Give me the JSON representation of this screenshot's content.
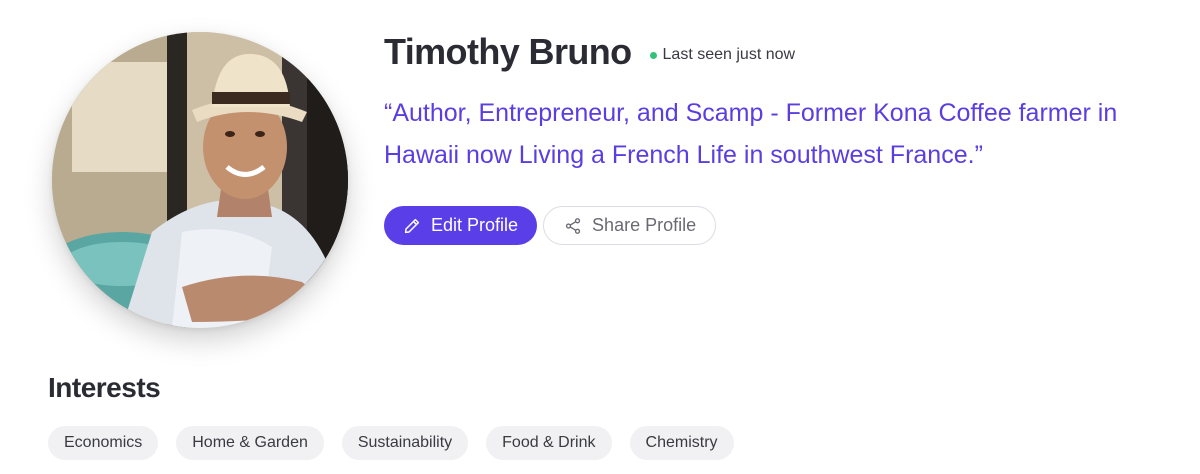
{
  "profile": {
    "name": "Timothy Bruno",
    "presence": "Last seen just now",
    "bio_line1": "“Author, Entrepreneur, and Scamp - Former Kona Coffee farmer in",
    "bio_line2": "Hawaii now Living a French Life in southwest France.”"
  },
  "actions": {
    "edit_label": "Edit Profile",
    "edit_icon": "pencil-icon",
    "share_label": "Share Profile",
    "share_icon": "share-icon"
  },
  "interests": {
    "title": "Interests",
    "tags": [
      "Economics",
      "Home & Garden",
      "Sustainability",
      "Food & Drink",
      "Chemistry"
    ]
  },
  "colors": {
    "accent": "#5a3ee8",
    "bio_text": "#5b3ee0",
    "presence_online": "#32c27a",
    "tag_bg": "#f1f1f3"
  }
}
